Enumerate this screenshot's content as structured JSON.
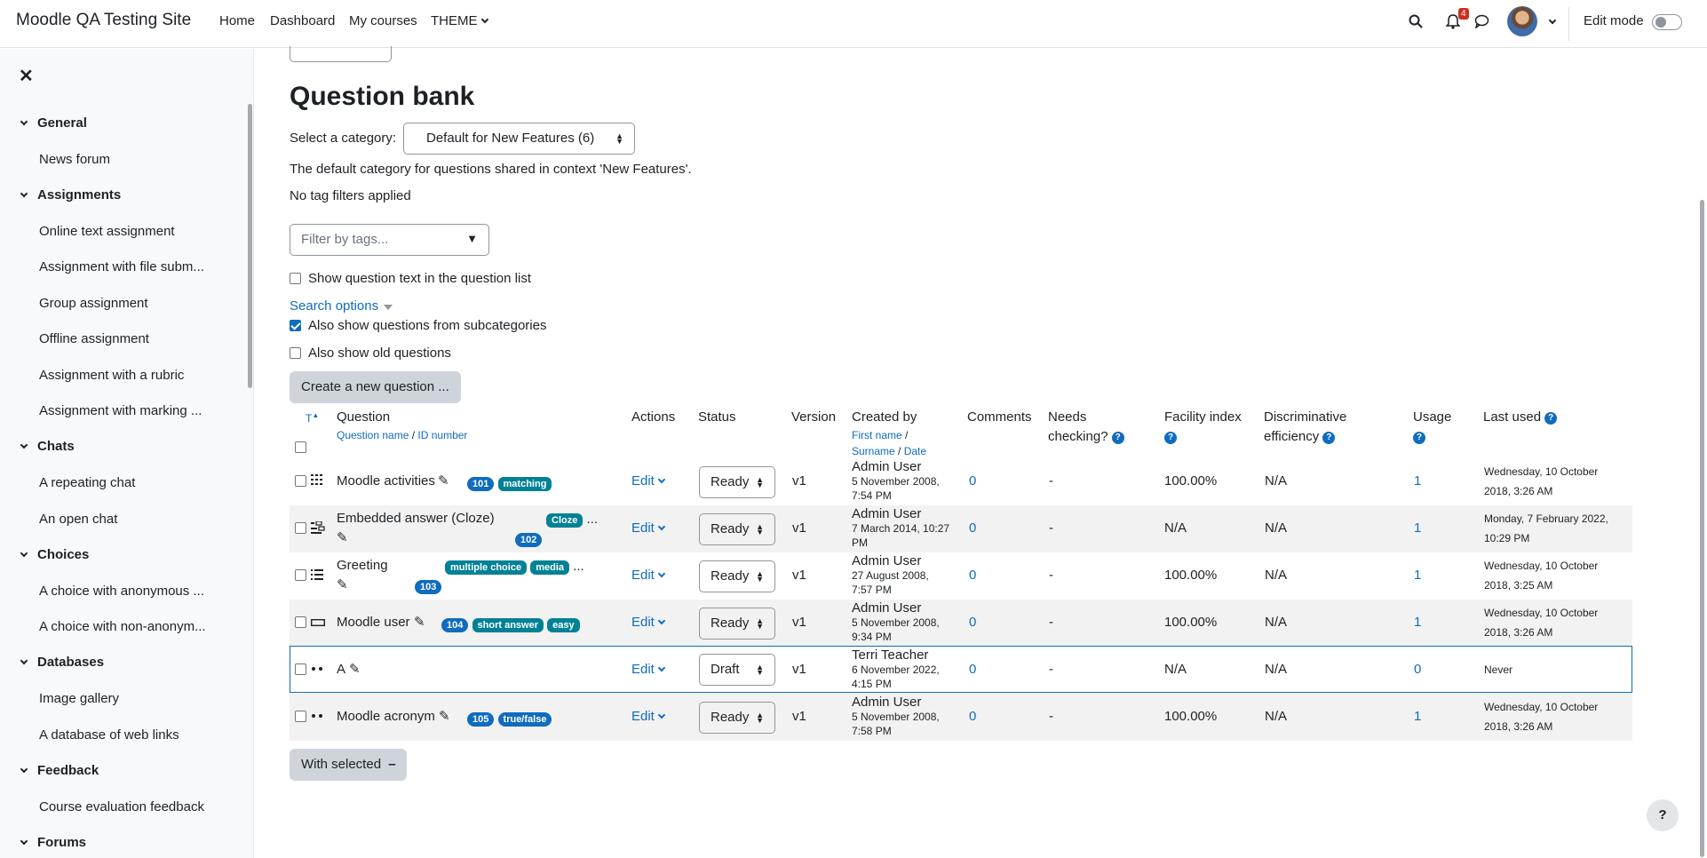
{
  "topnav": {
    "site_name": "Moodle QA Testing Site",
    "items": [
      "Home",
      "Dashboard",
      "My courses",
      "THEME"
    ],
    "notification_count": "4",
    "edit_mode_label": "Edit mode"
  },
  "drawer": {
    "sections": [
      {
        "title": "General",
        "items": [
          "News forum"
        ]
      },
      {
        "title": "Assignments",
        "items": [
          "Online text assignment",
          "Assignment with file subm...",
          "Group assignment",
          "Offline assignment",
          "Assignment with a rubric",
          "Assignment with marking ..."
        ]
      },
      {
        "title": "Chats",
        "items": [
          "A repeating chat",
          "An open chat"
        ]
      },
      {
        "title": "Choices",
        "items": [
          "A choice with anonymous ...",
          "A choice with non-anonym..."
        ]
      },
      {
        "title": "Databases",
        "items": [
          "Image gallery",
          "A database of web links"
        ]
      },
      {
        "title": "Feedback",
        "items": [
          "Course evaluation feedback"
        ]
      },
      {
        "title": "Forums",
        "items": []
      }
    ]
  },
  "page": {
    "title": "Question bank",
    "category_label": "Select a category:",
    "category_value": "Default for New Features (6)",
    "category_desc": "The default category for questions shared in context 'New Features'.",
    "tag_status": "No tag filters applied",
    "tag_placeholder": "Filter by tags...",
    "show_text_label": "Show question text in the question list",
    "search_options": "Search options",
    "subcat_label": "Also show questions from subcategories",
    "old_label": "Also show old questions",
    "create_button": "Create a new question ...",
    "with_selected": "With selected"
  },
  "table": {
    "headers": {
      "type": "T",
      "question": "Question",
      "question_sub_name": "Question name",
      "question_sub_sep": " / ",
      "question_sub_id": "ID number",
      "actions": "Actions",
      "status": "Status",
      "version": "Version",
      "created_by": "Created by",
      "created_sub_first": "First name",
      "created_sub_sep1": " /",
      "created_sub_surname": "Surname",
      "created_sub_sep2": " / ",
      "created_sub_date": "Date",
      "comments": "Comments",
      "needs_checking_1": "Needs",
      "needs_checking_2": "checking?",
      "facility": "Facility index",
      "discrim_1": "Discriminative",
      "discrim_2": "efficiency",
      "usage": "Usage",
      "last_used": "Last used"
    },
    "rows": [
      {
        "name": "Moodle activities",
        "id": "101",
        "tags": [
          "matching"
        ],
        "action": "Edit",
        "status": "Ready",
        "version": "v1",
        "creator": "Admin User",
        "date1": "5 November 2008,",
        "date2": "7:54 PM",
        "comments": "0",
        "needs": "-",
        "facility": "100.00%",
        "discrim": "N/A",
        "usage": "1",
        "last1": "Wednesday, 10 October",
        "last2": "2018, 3:26 AM"
      },
      {
        "name": "Embedded answer (Cloze)",
        "id": "102",
        "tags": [
          "Cloze"
        ],
        "more": "...",
        "action": "Edit",
        "status": "Ready",
        "version": "v1",
        "creator": "Admin User",
        "date1": "7 March 2014, 10:27",
        "date2": "PM",
        "comments": "0",
        "needs": "-",
        "facility": "N/A",
        "discrim": "N/A",
        "usage": "1",
        "last1": "Monday, 7 February 2022,",
        "last2": "10:29 PM"
      },
      {
        "name": "Greeting",
        "id": "103",
        "tags": [
          "multiple choice",
          "media"
        ],
        "more": "...",
        "action": "Edit",
        "status": "Ready",
        "version": "v1",
        "creator": "Admin User",
        "date1": "27 August 2008,",
        "date2": "7:57 PM",
        "comments": "0",
        "needs": "-",
        "facility": "100.00%",
        "discrim": "N/A",
        "usage": "1",
        "last1": "Wednesday, 10 October",
        "last2": "2018, 3:25 AM"
      },
      {
        "name": "Moodle user",
        "id": "104",
        "tags": [
          "short answer",
          "easy"
        ],
        "action": "Edit",
        "status": "Ready",
        "version": "v1",
        "creator": "Admin User",
        "date1": "5 November 2008,",
        "date2": "9:34 PM",
        "comments": "0",
        "needs": "-",
        "facility": "100.00%",
        "discrim": "N/A",
        "usage": "1",
        "last1": "Wednesday, 10 October",
        "last2": "2018, 3:26 AM"
      },
      {
        "name": "A",
        "action": "Edit",
        "status": "Draft",
        "version": "v1",
        "creator": "Terri Teacher",
        "date1": "6 November 2022,",
        "date2": "4:15 PM",
        "comments": "0",
        "needs": "-",
        "facility": "N/A",
        "discrim": "N/A",
        "usage": "0",
        "last1": "Never"
      },
      {
        "name": "Moodle acronym",
        "id": "105",
        "tags": [
          "true/false"
        ],
        "action": "Edit",
        "status": "Ready",
        "version": "v1",
        "creator": "Admin User",
        "date1": "5 November 2008,",
        "date2": "7:58 PM",
        "comments": "0",
        "needs": "-",
        "facility": "100.00%",
        "discrim": "N/A",
        "usage": "1",
        "last1": "Wednesday, 10 October",
        "last2": "2018, 3:26 AM"
      }
    ]
  },
  "help_fab": "?"
}
